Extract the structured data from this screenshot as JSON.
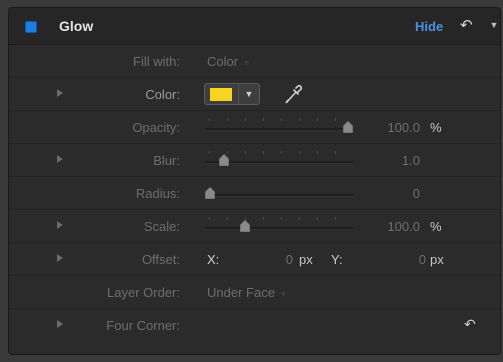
{
  "header": {
    "title": "Glow",
    "hide_label": "Hide",
    "reset_icon": "reset-arrow-icon",
    "menu_icon": "chevron-down-icon",
    "accent": "#1e7ee0"
  },
  "rows": {
    "fill_with": {
      "label": "Fill with:",
      "value": "Color",
      "arrows": "÷"
    },
    "color": {
      "label": "Color:",
      "swatch_color": "#f6d41f",
      "dropdown": "▼"
    },
    "opacity": {
      "label": "Opacity:",
      "value": "100.0",
      "unit": "%",
      "level": 1.0
    },
    "blur": {
      "label": "Blur:",
      "value": "1.0",
      "level": 0.1
    },
    "radius": {
      "label": "Radius:",
      "value": "0",
      "level": 0.0
    },
    "scale": {
      "label": "Scale:",
      "value": "100.0",
      "unit": "%",
      "level": 0.25
    },
    "offset": {
      "label": "Offset:",
      "x_label": "X:",
      "x_value": "0",
      "x_unit": "px",
      "y_label": "Y:",
      "y_value": "0",
      "y_unit": "px"
    },
    "layer_order": {
      "label": "Layer Order:",
      "value": "Under Face",
      "arrows": "÷"
    },
    "four_corner": {
      "label": "Four Corner:"
    }
  }
}
